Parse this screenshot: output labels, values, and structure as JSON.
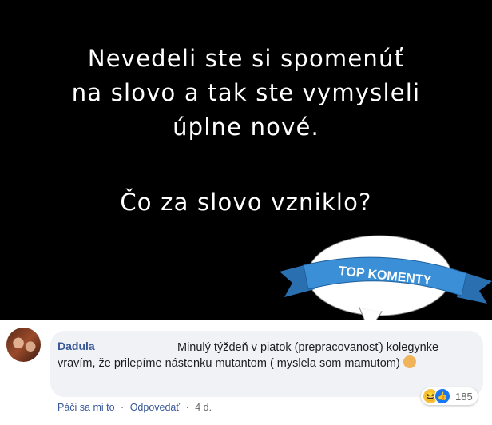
{
  "meme": {
    "headline_lines": [
      "Nevedeli ste si spomenúť",
      "na slovo a tak ste vymysleli",
      "úplne nové."
    ],
    "question": "Čo za slovo vzniklo?",
    "badge_label": "TOP KOMENTY"
  },
  "comment": {
    "author": "Dadula",
    "text": "Minulý týždeň v piatok (prepracovanosť) kolegynke vravím, že prilepíme nástenku mutantom ( myslela som mamutom)",
    "emoji_icon": "woman-shrugging-icon",
    "reaction_count": "185",
    "reaction_icons": [
      "haha-icon",
      "like-icon"
    ],
    "actions": {
      "like": "Páči sa mi to",
      "reply": "Odpovedať",
      "separator": "·",
      "time": "4 d."
    }
  },
  "colors": {
    "banner": "#000000",
    "badge_ribbon": "#3a8fd6",
    "author_link": "#385898",
    "comment_bubble": "#f0f2f5",
    "like_blue": "#1877f2"
  }
}
